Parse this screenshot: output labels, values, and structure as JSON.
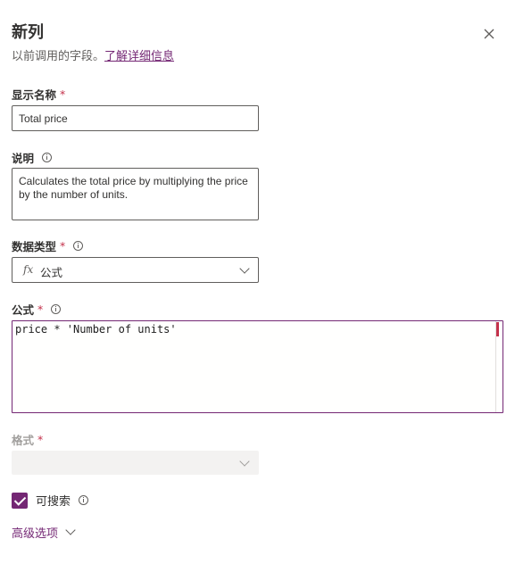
{
  "panel": {
    "title": "新列",
    "subtitle_text": "以前调用的字段。",
    "learn_more_link": "了解详细信息",
    "close_icon": "close-icon"
  },
  "display_name": {
    "label": "显示名称",
    "required_mark": "*",
    "value": "Total price"
  },
  "description": {
    "label": "说明",
    "info_icon": "info-icon",
    "value": "Calculates the total price by multiplying the price by the number of units."
  },
  "data_type": {
    "label": "数据类型",
    "required_mark": "*",
    "info_icon": "info-icon",
    "fx_glyph": "fx",
    "selected": "公式",
    "chevron_icon": "chevron-down-icon"
  },
  "formula": {
    "label": "公式",
    "required_mark": "*",
    "info_icon": "info-icon",
    "code": "price * 'Number of units'"
  },
  "format": {
    "label": "格式",
    "required_mark": "*",
    "selected": "",
    "chevron_icon": "chevron-down-icon"
  },
  "searchable": {
    "label": "可搜索",
    "checked": true,
    "info_icon": "info-icon"
  },
  "advanced_options": {
    "label": "高级选项",
    "chevron_icon": "chevron-down-icon"
  },
  "colors": {
    "accent": "#742774",
    "required": "#c4314b",
    "text": "#323130",
    "disabled_bg": "#f3f2f1"
  }
}
